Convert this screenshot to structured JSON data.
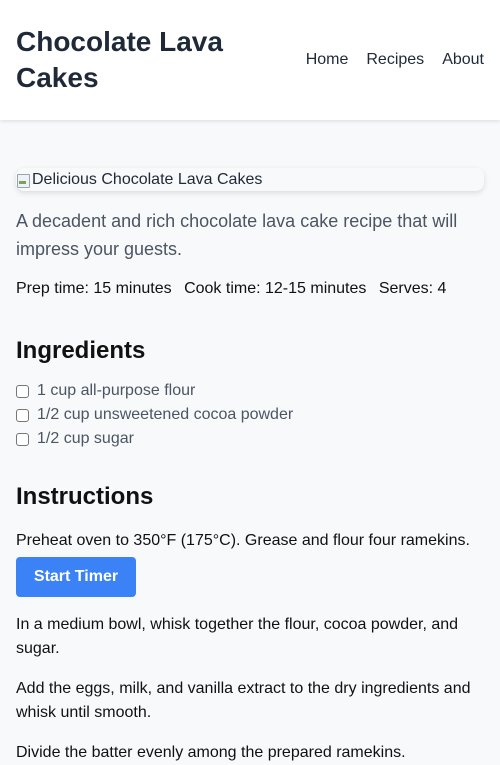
{
  "header": {
    "title": "Chocolate Lava Cakes",
    "nav": [
      "Home",
      "Recipes",
      "About"
    ]
  },
  "hero": {
    "alt": "Delicious Chocolate Lava Cakes"
  },
  "description": "A decadent and rich chocolate lava cake recipe that will impress your guests.",
  "meta": {
    "prep": "Prep time: 15 minutes",
    "cook": "Cook time: 12-15 minutes",
    "serves": "Serves: 4"
  },
  "ingredients": {
    "heading": "Ingredients",
    "items": [
      {
        "label": "1 cup all-purpose flour",
        "checked": false
      },
      {
        "label": "1/2 cup unsweetened cocoa powder",
        "checked": false
      },
      {
        "label": "1/2 cup sugar",
        "checked": false
      }
    ]
  },
  "instructions": {
    "heading": "Instructions",
    "steps": [
      "Preheat oven to 350°F (175°C). Grease and flour four ramekins.",
      "In a medium bowl, whisk together the flour, cocoa powder, and sugar.",
      "Add the eggs, milk, and vanilla extract to the dry ingredients and whisk until smooth.",
      "Divide the batter evenly among the prepared ramekins."
    ],
    "timer_button": "Start Timer"
  },
  "colors": {
    "accent": "#3b82f6",
    "header_bg": "#ffffff",
    "page_bg": "#f8f9fa"
  }
}
